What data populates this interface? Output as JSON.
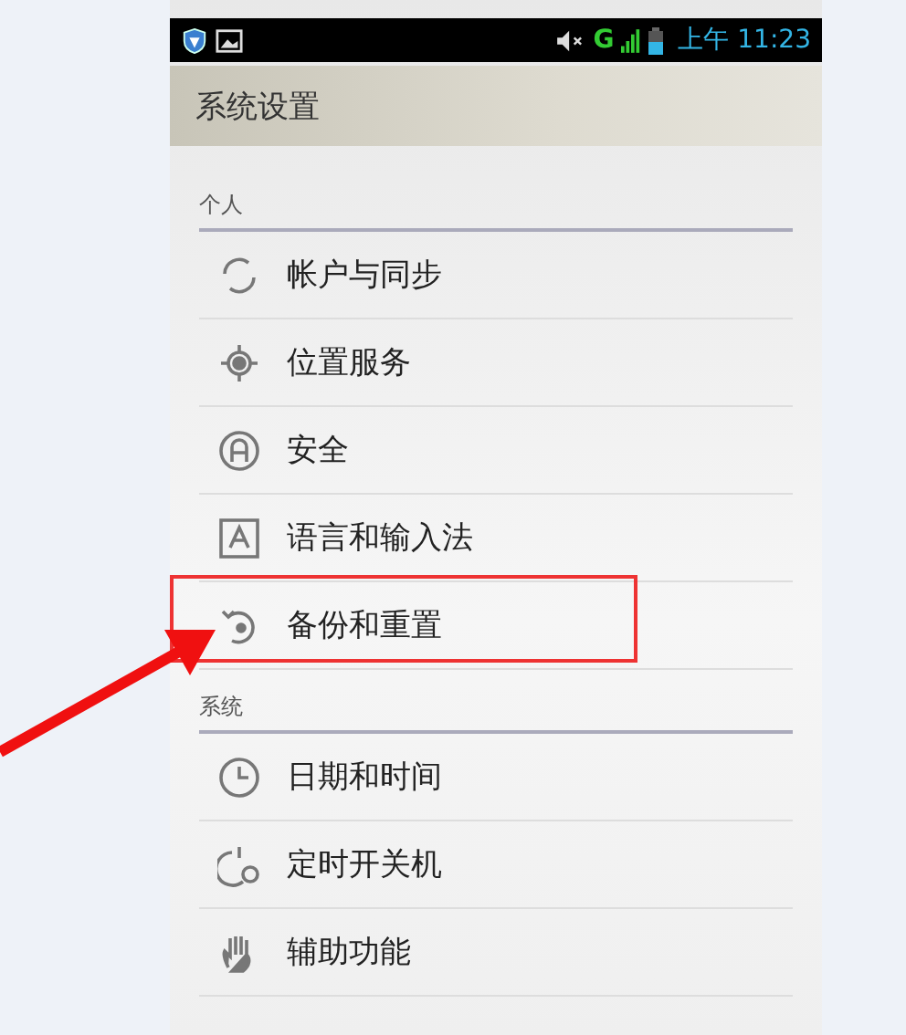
{
  "status_bar": {
    "network": "G",
    "time": "上午 11:23"
  },
  "title": "系统设置",
  "sections": [
    {
      "header": "个人",
      "items": [
        {
          "label": "帐户与同步",
          "kind": "sync",
          "highlighted": false
        },
        {
          "label": "位置服务",
          "kind": "location",
          "highlighted": false
        },
        {
          "label": "安全",
          "kind": "lock",
          "highlighted": false
        },
        {
          "label": "语言和输入法",
          "kind": "language",
          "highlighted": false
        },
        {
          "label": "备份和重置",
          "kind": "backup",
          "highlighted": true
        }
      ]
    },
    {
      "header": "系统",
      "items": [
        {
          "label": "日期和时间",
          "kind": "clock",
          "highlighted": false
        },
        {
          "label": "定时开关机",
          "kind": "power",
          "highlighted": false
        },
        {
          "label": "辅助功能",
          "kind": "hand",
          "highlighted": false
        }
      ]
    }
  ]
}
